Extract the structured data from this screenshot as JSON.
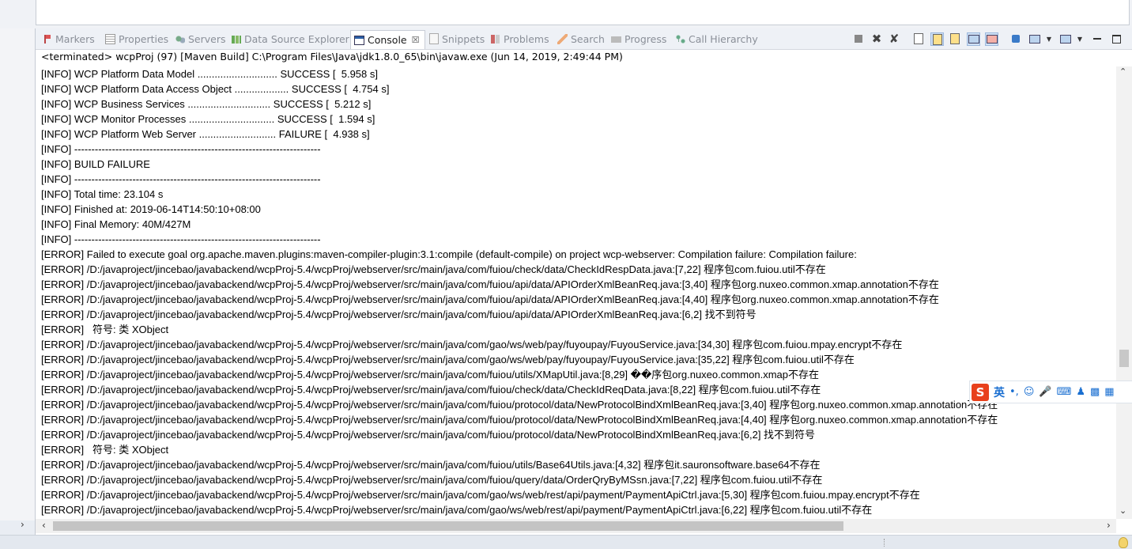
{
  "tabs": [
    {
      "label": "Markers",
      "icon": "markers-icon"
    },
    {
      "label": "Properties",
      "icon": "properties-icon"
    },
    {
      "label": "Servers",
      "icon": "servers-icon"
    },
    {
      "label": "Data Source Explorer",
      "icon": "data-source-icon"
    },
    {
      "label": "Console",
      "icon": "console-icon",
      "active": true,
      "close": "☒"
    },
    {
      "label": "Snippets",
      "icon": "snippets-icon"
    },
    {
      "label": "Problems",
      "icon": "problems-icon"
    },
    {
      "label": "Search",
      "icon": "search-icon"
    },
    {
      "label": "Progress",
      "icon": "progress-icon"
    },
    {
      "label": "Call Hierarchy",
      "icon": "call-hierarchy-icon"
    }
  ],
  "status": "<terminated> wcpProj (97) [Maven Build] C:\\Program Files\\Java\\jdk1.8.0_65\\bin\\javaw.exe (Jun 14, 2019, 2:49:44 PM)",
  "console_lines": [
    "[INFO] WCP Platform Data Model ............................ SUCCESS [  5.958 s]",
    "[INFO] WCP Platform Data Access Object ................... SUCCESS [  4.754 s]",
    "[INFO] WCP Business Services ............................. SUCCESS [  5.212 s]",
    "[INFO] WCP Monitor Processes .............................. SUCCESS [  1.594 s]",
    "[INFO] WCP Platform Web Server ........................... FAILURE [  4.938 s]",
    "[INFO] ------------------------------------------------------------------------",
    "[INFO] BUILD FAILURE",
    "[INFO] ------------------------------------------------------------------------",
    "[INFO] Total time: 23.104 s",
    "[INFO] Finished at: 2019-06-14T14:50:10+08:00",
    "[INFO] Final Memory: 40M/427M",
    "[INFO] ------------------------------------------------------------------------",
    "[ERROR] Failed to execute goal org.apache.maven.plugins:maven-compiler-plugin:3.1:compile (default-compile) on project wcp-webserver: Compilation failure: Compilation failure:",
    "[ERROR] /D:/javaproject/jincebao/javabackend/wcpProj-5.4/wcpProj/webserver/src/main/java/com/fuiou/check/data/CheckIdRespData.java:[7,22] 程序包com.fuiou.util不存在",
    "[ERROR] /D:/javaproject/jincebao/javabackend/wcpProj-5.4/wcpProj/webserver/src/main/java/com/fuiou/api/data/APIOrderXmlBeanReq.java:[3,40] 程序包org.nuxeo.common.xmap.annotation不存在",
    "[ERROR] /D:/javaproject/jincebao/javabackend/wcpProj-5.4/wcpProj/webserver/src/main/java/com/fuiou/api/data/APIOrderXmlBeanReq.java:[4,40] 程序包org.nuxeo.common.xmap.annotation不存在",
    "[ERROR] /D:/javaproject/jincebao/javabackend/wcpProj-5.4/wcpProj/webserver/src/main/java/com/fuiou/api/data/APIOrderXmlBeanReq.java:[6,2] 找不到符号",
    "[ERROR]   符号: 类 XObject",
    "[ERROR] /D:/javaproject/jincebao/javabackend/wcpProj-5.4/wcpProj/webserver/src/main/java/com/gao/ws/web/pay/fuyoupay/FuyouService.java:[34,30] 程序包com.fuiou.mpay.encrypt不存在",
    "[ERROR] /D:/javaproject/jincebao/javabackend/wcpProj-5.4/wcpProj/webserver/src/main/java/com/gao/ws/web/pay/fuyoupay/FuyouService.java:[35,22] 程序包com.fuiou.util不存在",
    "[ERROR] /D:/javaproject/jincebao/javabackend/wcpProj-5.4/wcpProj/webserver/src/main/java/com/fuiou/utils/XMapUtil.java:[8,29] ��序包org.nuxeo.common.xmap不存在",
    "[ERROR] /D:/javaproject/jincebao/javabackend/wcpProj-5.4/wcpProj/webserver/src/main/java/com/fuiou/check/data/CheckIdReqData.java:[8,22] 程序包com.fuiou.util不存在",
    "[ERROR] /D:/javaproject/jincebao/javabackend/wcpProj-5.4/wcpProj/webserver/src/main/java/com/fuiou/protocol/data/NewProtocolBindXmlBeanReq.java:[3,40] 程序包org.nuxeo.common.xmap.annotation不存在",
    "[ERROR] /D:/javaproject/jincebao/javabackend/wcpProj-5.4/wcpProj/webserver/src/main/java/com/fuiou/protocol/data/NewProtocolBindXmlBeanReq.java:[4,40] 程序包org.nuxeo.common.xmap.annotation不存在",
    "[ERROR] /D:/javaproject/jincebao/javabackend/wcpProj-5.4/wcpProj/webserver/src/main/java/com/fuiou/protocol/data/NewProtocolBindXmlBeanReq.java:[6,2] 找不到符号",
    "[ERROR]   符号: 类 XObject",
    "[ERROR] /D:/javaproject/jincebao/javabackend/wcpProj-5.4/wcpProj/webserver/src/main/java/com/fuiou/utils/Base64Utils.java:[4,32] 程序包it.sauronsoftware.base64不存在",
    "[ERROR] /D:/javaproject/jincebao/javabackend/wcpProj-5.4/wcpProj/webserver/src/main/java/com/fuiou/query/data/OrderQryByMSsn.java:[7,22] 程序包com.fuiou.util不存在",
    "[ERROR] /D:/javaproject/jincebao/javabackend/wcpProj-5.4/wcpProj/webserver/src/main/java/com/gao/ws/web/rest/api/payment/PaymentApiCtrl.java:[5,30] 程序包com.fuiou.mpay.encrypt不存在",
    "[ERROR] /D:/javaproject/jincebao/javabackend/wcpProj-5.4/wcpProj/webserver/src/main/java/com/gao/ws/web/rest/api/payment/PaymentApiCtrl.java:[6,22] 程序包com.fuiou.util不存在"
  ],
  "toolbar_icons": [
    "terminate-icon",
    "remove-launch-icon",
    "remove-all-terminated-icon",
    "clear-console-icon",
    "scroll-lock-icon",
    "word-wrap-icon",
    "show-on-stdout-icon",
    "show-on-stderr-icon",
    "pin-console-icon",
    "display-console-icon",
    "open-console-icon",
    "minimize-icon",
    "maximize-icon"
  ],
  "ime": {
    "logo": "S",
    "mode": "英"
  }
}
